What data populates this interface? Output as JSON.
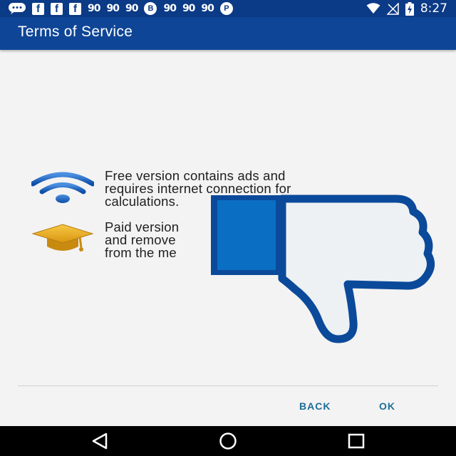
{
  "status_bar": {
    "left_icons": [
      {
        "name": "chat-bubble-icon",
        "type": "bubble"
      },
      {
        "name": "facebook-icon",
        "type": "fb",
        "glyph": "f"
      },
      {
        "name": "facebook-icon",
        "type": "fb",
        "glyph": "f"
      },
      {
        "name": "facebook-icon",
        "type": "fb",
        "glyph": "f"
      },
      {
        "name": "app-notification-icon",
        "type": "text",
        "glyph": "90"
      },
      {
        "name": "app-notification-icon",
        "type": "text",
        "glyph": "90"
      },
      {
        "name": "app-notification-icon",
        "type": "text",
        "glyph": "90"
      },
      {
        "name": "b-app-icon",
        "type": "circle",
        "glyph": "B"
      },
      {
        "name": "app-notification-icon",
        "type": "text",
        "glyph": "90"
      },
      {
        "name": "app-notification-icon",
        "type": "text",
        "glyph": "90"
      },
      {
        "name": "app-notification-icon",
        "type": "text",
        "glyph": "90"
      },
      {
        "name": "pinterest-icon",
        "type": "circle",
        "glyph": "P"
      }
    ],
    "time": "8:27"
  },
  "app_bar": {
    "title": "Terms of Service"
  },
  "terms": {
    "free": {
      "line1": "Free version contains ads and",
      "line2": "requires internet connection for",
      "line3": "calculations."
    },
    "paid": {
      "line1": "Paid version",
      "line2": "and remove",
      "line3": "from the me"
    }
  },
  "buttons": {
    "back": "BACK",
    "ok": "OK"
  },
  "colors": {
    "status_bar": "#0b3a86",
    "app_bar": "#0e4596",
    "background": "#f3f3f3",
    "button_text": "#1d6e97",
    "wifi_icon": "#1a5fb4",
    "grad_cap": "#e8a81c",
    "thumb_outline": "#0b4a9a",
    "thumb_fill": "#edf1f4",
    "thumb_cuff": "#0a6fc2"
  }
}
